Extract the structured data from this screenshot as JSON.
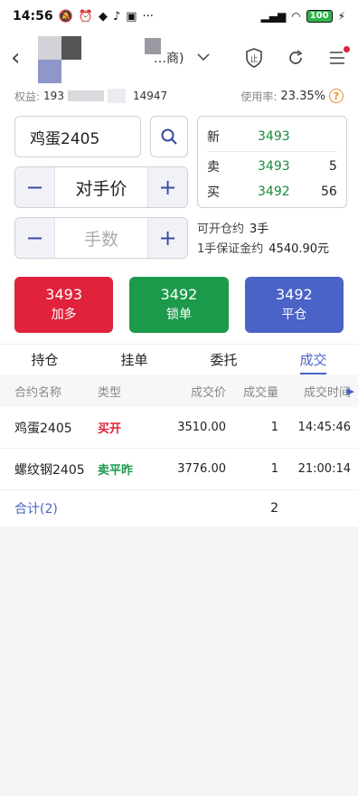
{
  "status": {
    "time": "14:56",
    "battery": "100"
  },
  "nav": {
    "title": "…商)",
    "chevron": "⌄"
  },
  "equity": {
    "label": "权益:",
    "value_prefix": "193",
    "value_suffix": "14947",
    "ratio_label": "使用率:",
    "ratio_value": "23.35%",
    "help": "?"
  },
  "order": {
    "symbol": "鸡蛋2405",
    "price_mode": "对手价",
    "qty_placeholder": "手数",
    "minus": "−",
    "plus": "+"
  },
  "quote": {
    "rows": [
      {
        "label": "新",
        "price": "3493",
        "vol": ""
      },
      {
        "label": "卖",
        "price": "3493",
        "vol": "5"
      },
      {
        "label": "买",
        "price": "3492",
        "vol": "56"
      }
    ]
  },
  "info": {
    "open_label": "可开仓约",
    "open_value": "3手",
    "margin_label": "1手保证金约",
    "margin_value": "4540.90元"
  },
  "buttons": {
    "buy": {
      "price": "3493",
      "label": "加多"
    },
    "lock": {
      "price": "3492",
      "label": "锁单"
    },
    "close": {
      "price": "3492",
      "label": "平仓"
    }
  },
  "tabs": [
    "持仓",
    "挂单",
    "委托",
    "成交"
  ],
  "table": {
    "headers": [
      "合约名称",
      "类型",
      "成交价",
      "成交量",
      "成交时间"
    ],
    "rows": [
      {
        "name": "鸡蛋2405",
        "type": "买开",
        "price": "3510.00",
        "qty": "1",
        "time": "14:45:46"
      },
      {
        "name": "螺纹钢2405",
        "type": "卖平昨",
        "price": "3776.00",
        "qty": "1",
        "time": "21:00:14"
      }
    ],
    "total_label": "合计(2)",
    "total_qty": "2"
  },
  "colors": {
    "red": "#e0223a",
    "green": "#1c9a4b",
    "blue": "#4a63c6"
  }
}
